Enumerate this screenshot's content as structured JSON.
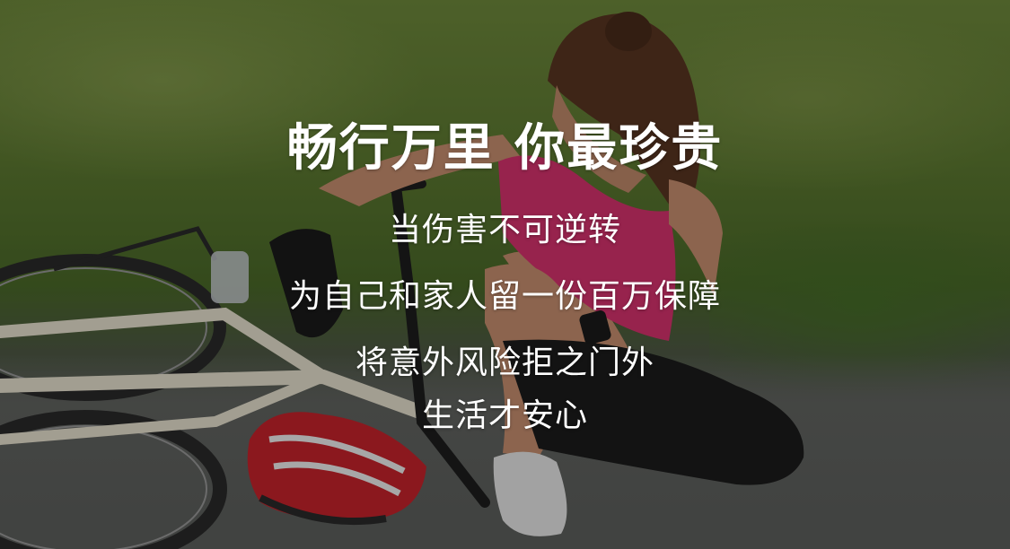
{
  "banner": {
    "headline": "畅行万里 你最珍贵",
    "lines": [
      "当伤害不可逆转",
      "为自己和家人留一份百万保障",
      "将意外风险拒之门外",
      "生活才安心"
    ]
  },
  "colors": {
    "text": "#ffffff",
    "shirt": "#d8336f",
    "helmet": "#c8232b",
    "grass": "#5d7a31",
    "road": "#5d605d"
  }
}
